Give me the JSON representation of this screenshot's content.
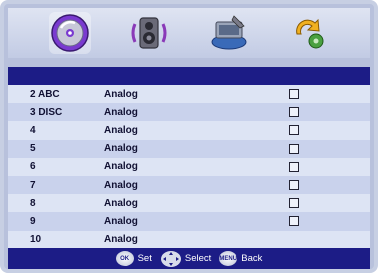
{
  "tabs": [
    {
      "name": "disc-icon",
      "selected": true
    },
    {
      "name": "speaker-icon",
      "selected": false
    },
    {
      "name": "setup-icon",
      "selected": false
    },
    {
      "name": "refresh-icon",
      "selected": false
    }
  ],
  "channels": [
    {
      "number": "2 ABC",
      "type": "Analog",
      "has_checkbox": true
    },
    {
      "number": "3 DISC",
      "type": "Analog",
      "has_checkbox": true
    },
    {
      "number": "4",
      "type": "Analog",
      "has_checkbox": true
    },
    {
      "number": "5",
      "type": "Analog",
      "has_checkbox": true
    },
    {
      "number": "6",
      "type": "Analog",
      "has_checkbox": true
    },
    {
      "number": "7",
      "type": "Analog",
      "has_checkbox": true
    },
    {
      "number": "8",
      "type": "Analog",
      "has_checkbox": true
    },
    {
      "number": "9",
      "type": "Analog",
      "has_checkbox": true
    },
    {
      "number": "10",
      "type": "Analog",
      "has_checkbox": false
    }
  ],
  "footer": {
    "ok_button": "OK",
    "set_label": "Set",
    "select_label": "Select",
    "menu_button": "MENU",
    "back_label": "Back"
  }
}
